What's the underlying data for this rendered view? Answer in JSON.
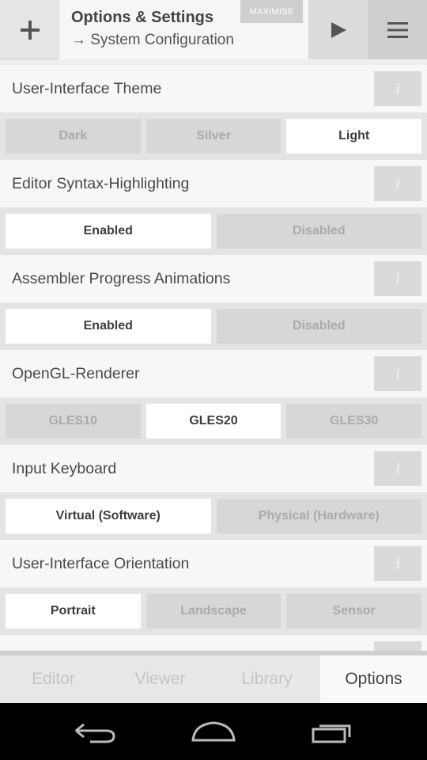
{
  "header": {
    "title": "Options & Settings",
    "subtitle": "→ System Configuration",
    "maximise_label": "MAXIMISE"
  },
  "settings": [
    {
      "label": "User-Interface Theme",
      "info": "i",
      "options": [
        {
          "label": "Dark",
          "selected": false
        },
        {
          "label": "Silver",
          "selected": false
        },
        {
          "label": "Light",
          "selected": true
        }
      ]
    },
    {
      "label": "Editor Syntax-Highlighting",
      "info": "i",
      "options": [
        {
          "label": "Enabled",
          "selected": true
        },
        {
          "label": "Disabled",
          "selected": false
        }
      ]
    },
    {
      "label": "Assembler Progress Animations",
      "info": "i",
      "options": [
        {
          "label": "Enabled",
          "selected": true
        },
        {
          "label": "Disabled",
          "selected": false
        }
      ]
    },
    {
      "label": "OpenGL-Renderer",
      "info": "i",
      "options": [
        {
          "label": "GLES10",
          "selected": false
        },
        {
          "label": "GLES20",
          "selected": true
        },
        {
          "label": "GLES30",
          "selected": false
        }
      ]
    },
    {
      "label": "Input Keyboard",
      "info": "i",
      "options": [
        {
          "label": "Virtual (Software)",
          "selected": true
        },
        {
          "label": "Physical (Hardware)",
          "selected": false
        }
      ]
    },
    {
      "label": "User-Interface Orientation",
      "info": "i",
      "options": [
        {
          "label": "Portrait",
          "selected": true
        },
        {
          "label": "Landscape",
          "selected": false
        },
        {
          "label": "Sensor",
          "selected": false
        }
      ]
    }
  ],
  "tabs": [
    {
      "label": "Editor",
      "active": false
    },
    {
      "label": "Viewer",
      "active": false
    },
    {
      "label": "Library",
      "active": false
    },
    {
      "label": "Options",
      "active": true
    }
  ],
  "icons": {
    "add": "plus-icon",
    "run": "play-icon",
    "menu": "hamburger-menu-icon",
    "back": "back-icon",
    "home": "home-icon",
    "recents": "recent-apps-icon"
  },
  "colors": {
    "selected_option": "#ffffff",
    "unselected_option": "#d7d7d7",
    "active_tab": "#fafafa"
  }
}
